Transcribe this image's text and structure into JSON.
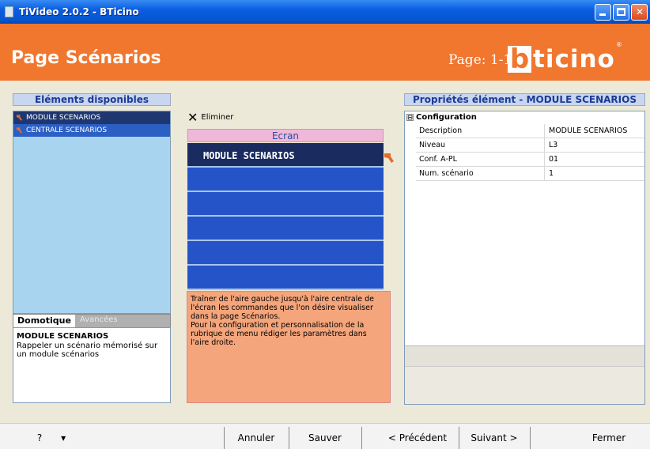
{
  "window": {
    "title": "TiVideo 2.0.2 - BTicino"
  },
  "header": {
    "page_title": "Page Scénarios",
    "page_number": "Page: 1-1",
    "logo_b": "b",
    "logo_rest": "ticino",
    "logo_reg": "®"
  },
  "left_panel": {
    "title": "Eléments disponibles",
    "items": [
      {
        "label": "MODULE SCENARIOS"
      },
      {
        "label": "CENTRALE SCENARIOS"
      }
    ],
    "tabs": [
      {
        "label": "Domotique"
      },
      {
        "label": "Avancées"
      }
    ],
    "description_title": "MODULE SCENARIOS",
    "description_text": "Rappeler un scénario mémorisé sur un module scénarios"
  },
  "center_panel": {
    "delete_label": "Eliminer",
    "screen_title": "Ecran",
    "slots": [
      "MODULE SCENARIOS",
      "",
      "",
      "",
      "",
      ""
    ],
    "info_text_1": "Traîner de l'aire gauche jusqu'à l'aire centrale de l'écran les commandes que l'on désire visualiser dans la page Scénarios.",
    "info_text_2": "Pour la configuration et personnalisation de la rubrique de menu rédiger les paramètres dans l'aire droite."
  },
  "right_panel": {
    "title": "Propriétés élément - MODULE SCENARIOS",
    "category": "Configuration",
    "toggle": "⊟",
    "rows": [
      {
        "key": "Description",
        "value": "MODULE SCENARIOS"
      },
      {
        "key": "Niveau",
        "value": "L3"
      },
      {
        "key": "Conf. A-PL",
        "value": "01"
      },
      {
        "key": "Num. scénario",
        "value": "1"
      }
    ]
  },
  "footer": {
    "help_label": "?",
    "help_arrow": "▾",
    "cancel_label": "Annuler",
    "save_label": "Sauver",
    "prev_label": "< Précédent",
    "next_label": "Suivant >",
    "close_label": "Fermer"
  }
}
